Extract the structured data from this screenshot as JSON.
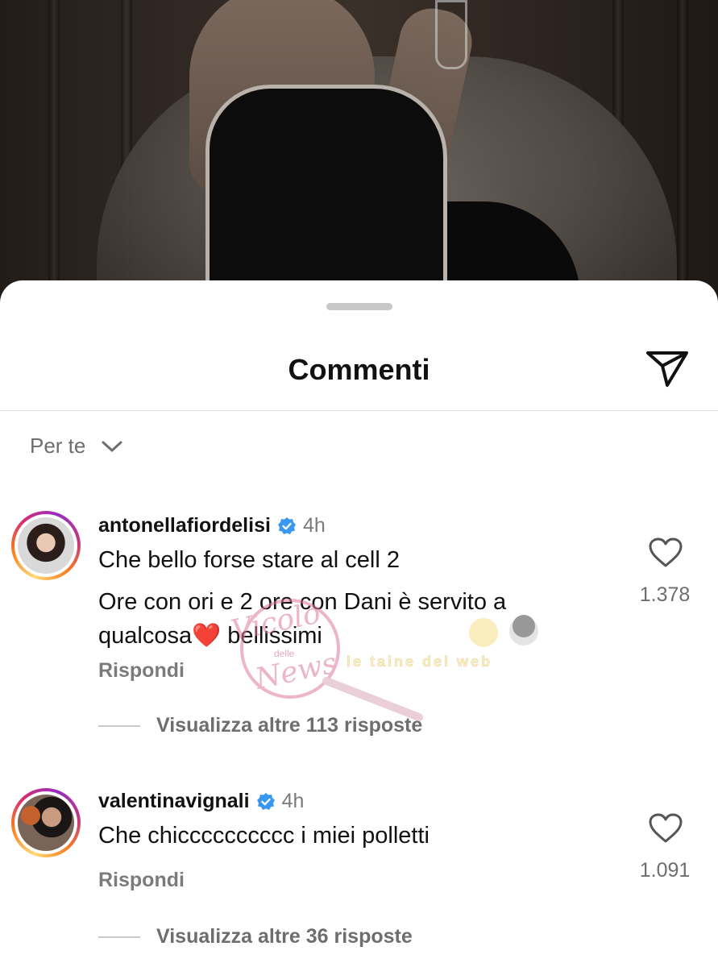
{
  "sheet": {
    "title": "Commenti",
    "sort_label": "Per te"
  },
  "comments": [
    {
      "username": "antonellafiordelisi",
      "time": "4h",
      "lines": [
        "Che bello forse stare al cell 2",
        "Ore con ori e 2 ore con Dani è servito a",
        "qualcosa❤️ bellissimi"
      ],
      "reply_label": "Rispondi",
      "likes": "1.378",
      "replies_label": "Visualizza altre 113 risposte"
    },
    {
      "username": "valentinavignali",
      "time": "4h",
      "lines": [
        "Che chicccccccccc i miei polletti"
      ],
      "reply_label": "Rispondi",
      "likes": "1.091",
      "replies_label": "Visualizza altre 36 risposte"
    }
  ],
  "watermark": {
    "brand_left": "Vicolo delle News",
    "brand_right": "le taine del web"
  },
  "icons": {
    "share": "paper-plane-icon",
    "sort": "chevron-down-icon",
    "verified": "verified-badge-icon",
    "like": "heart-icon"
  },
  "colors": {
    "verified": "#3897f0",
    "muted_text": "#7b7b7b",
    "sheet_bg": "#ffffff"
  }
}
